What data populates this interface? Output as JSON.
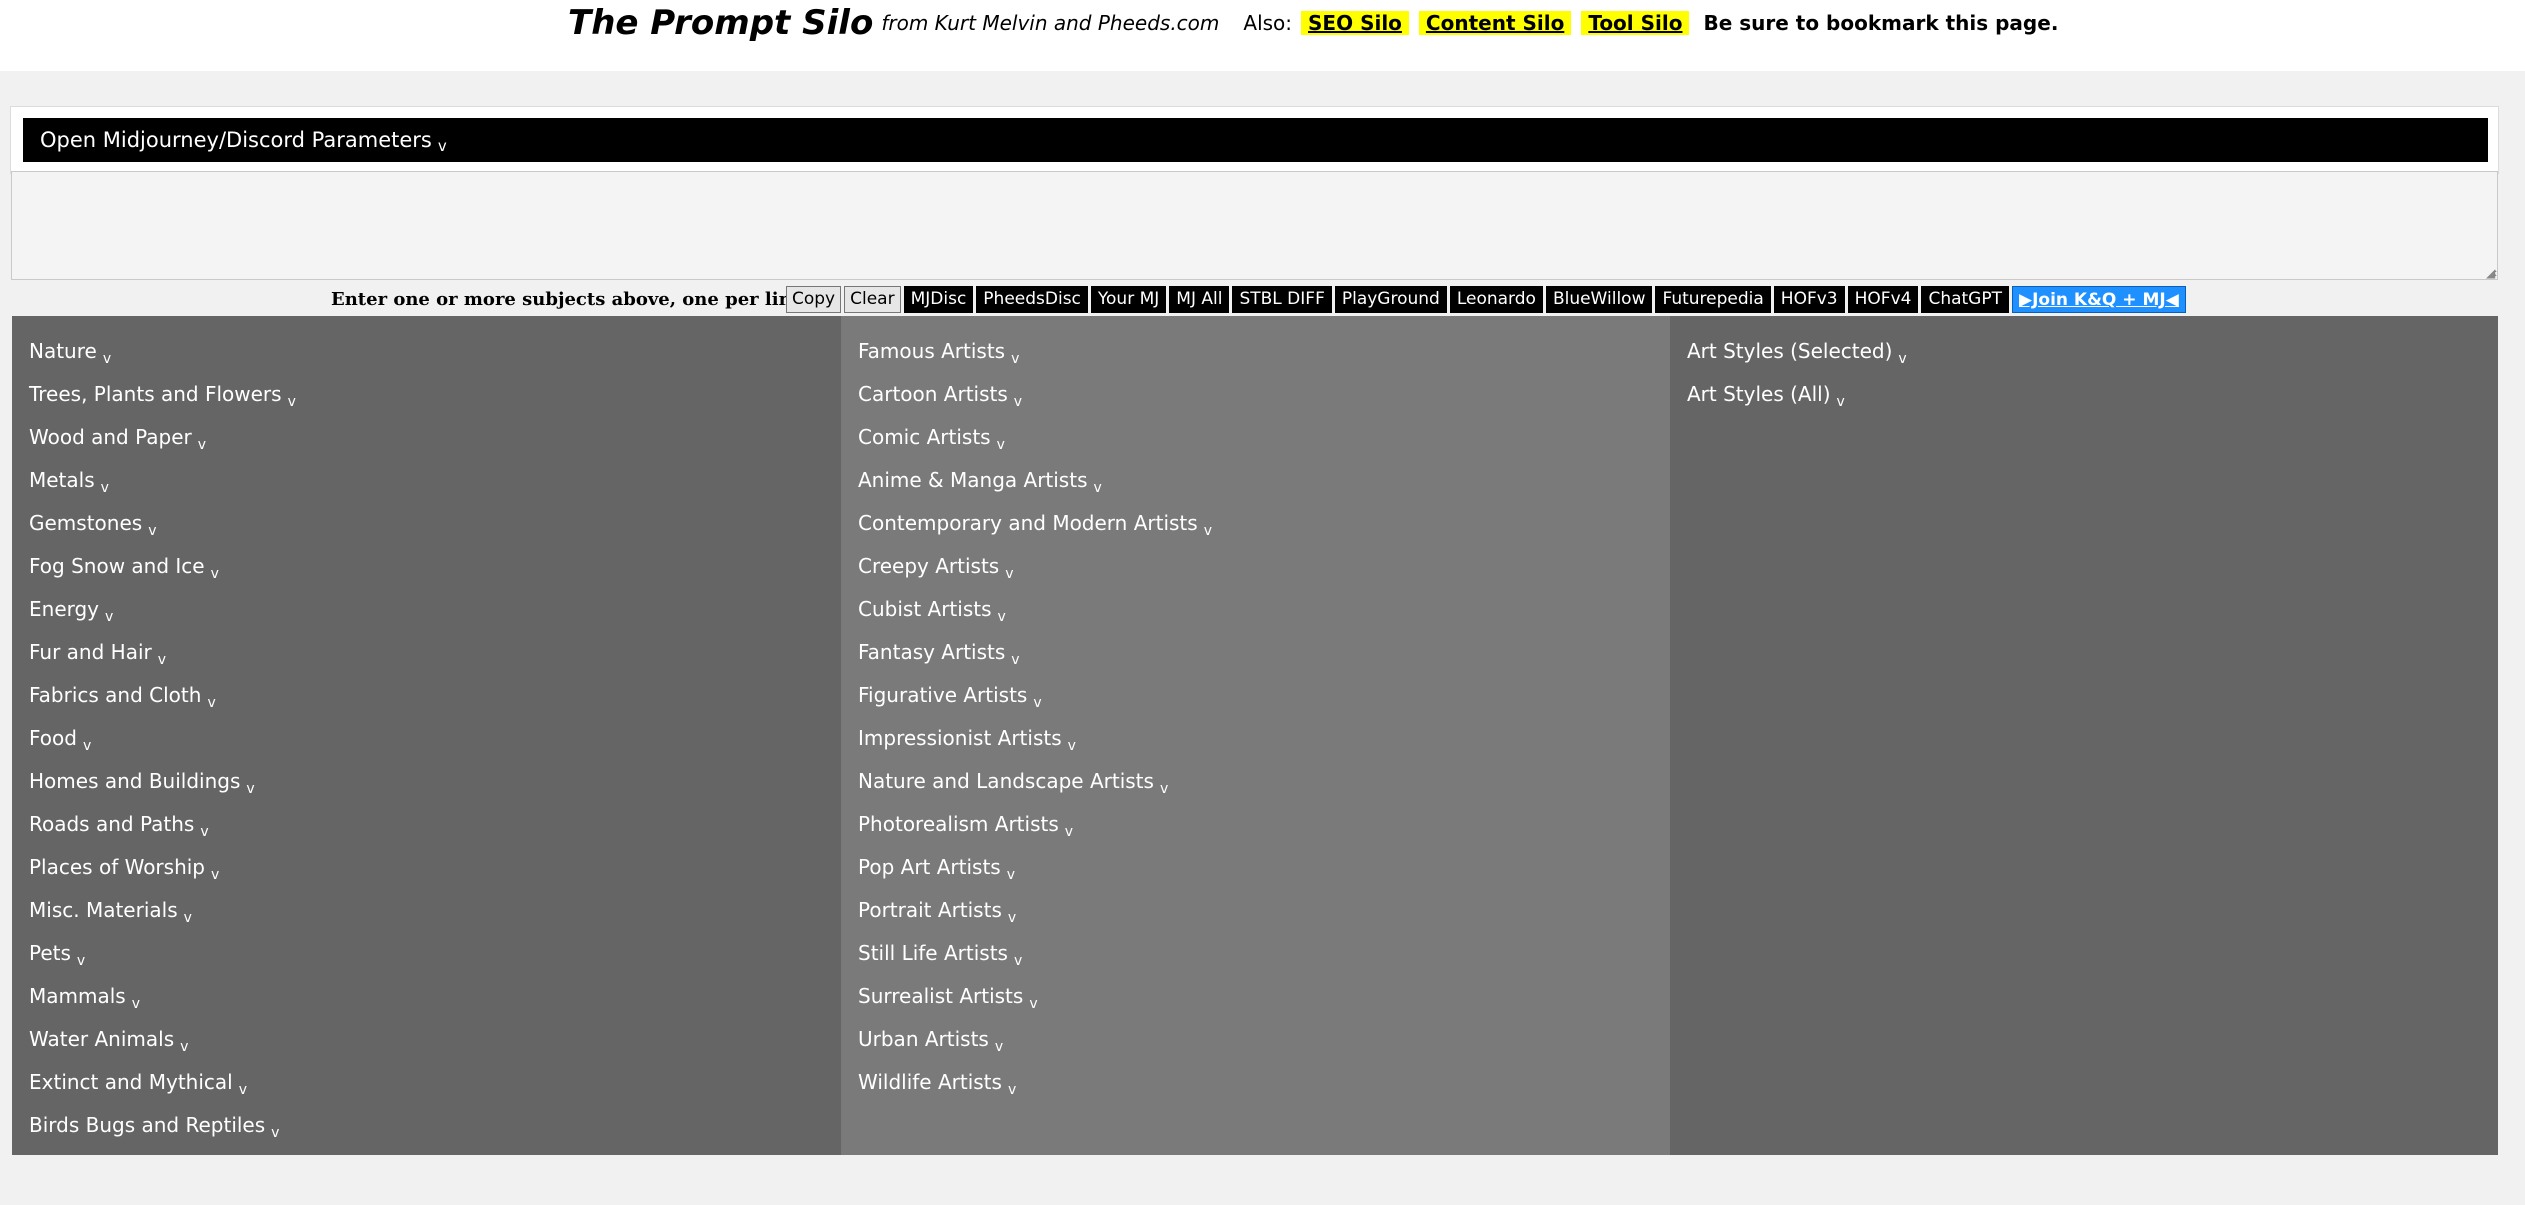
{
  "header": {
    "title": "The Prompt Silo",
    "byline": "from Kurt Melvin and Pheeds.com",
    "also_label": "Also:",
    "links": [
      "SEO Silo",
      "Content Silo",
      "Tool Silo"
    ],
    "bookmark_text": "Be sure to bookmark this page."
  },
  "params": {
    "label": "Open Midjourney/Discord Parameters",
    "caret": "v"
  },
  "subjects": {
    "value": ""
  },
  "toolbar": {
    "hint": "Enter one or more subjects above, one per line.",
    "copy_label": "Copy",
    "clear_label": "Clear",
    "buttons": [
      "MJDisc",
      "PheedsDisc",
      "Your MJ",
      "MJ All",
      "STBL DIFF",
      "PlayGround",
      "Leonardo",
      "BlueWillow",
      "Futurepedia",
      "HOFv3",
      "HOFv4",
      "ChatGPT"
    ],
    "join_label": "▶Join K&Q + MJ◀"
  },
  "colors": {
    "accent": "#1e90ff",
    "highlight": "#ffff00",
    "col_dark": "#656565",
    "col_light": "#7a7a7a"
  },
  "columns": {
    "subjects": [
      "Nature",
      "Trees, Plants and Flowers",
      "Wood and Paper",
      "Metals",
      "Gemstones",
      "Fog Snow and Ice",
      "Energy",
      "Fur and Hair",
      "Fabrics and Cloth",
      "Food",
      "Homes and Buildings",
      "Roads and Paths",
      "Places of Worship",
      "Misc. Materials",
      "Pets",
      "Mammals",
      "Water Animals",
      "Extinct and Mythical",
      "Birds Bugs and Reptiles"
    ],
    "artists": [
      "Famous Artists",
      "Cartoon Artists",
      "Comic Artists",
      "Anime & Manga Artists",
      "Contemporary and Modern Artists",
      "Creepy Artists",
      "Cubist Artists",
      "Fantasy Artists",
      "Figurative Artists",
      "Impressionist Artists",
      "Nature and Landscape Artists",
      "Photorealism Artists",
      "Pop Art Artists",
      "Portrait Artists",
      "Still Life Artists",
      "Surrealist Artists",
      "Urban Artists",
      "Wildlife Artists"
    ],
    "styles": [
      "Art Styles (Selected)",
      "Art Styles (All)"
    ]
  }
}
